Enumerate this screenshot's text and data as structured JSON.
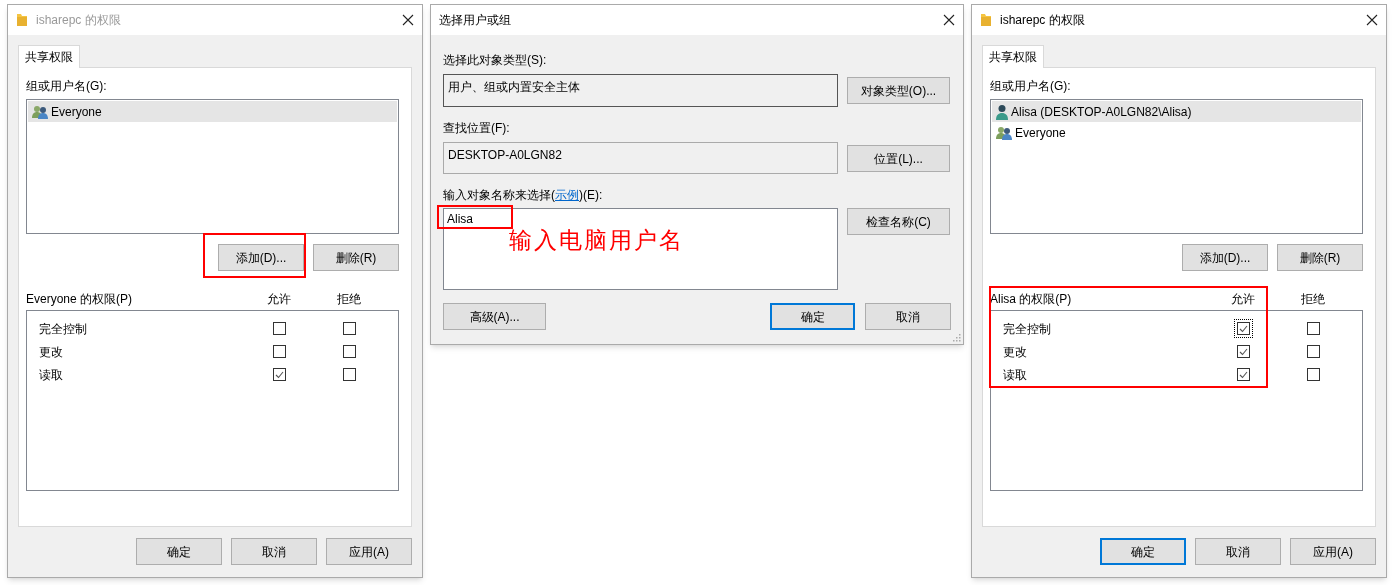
{
  "dialogs": [
    {
      "kind": "permissions",
      "title": "isharepc 的权限",
      "active": false,
      "tabs": [
        {
          "label": "共享权限",
          "selected": true
        }
      ],
      "group_label": "组或用户名(G):",
      "principals": [
        {
          "name": "Everyone",
          "kind": "group",
          "selected": true
        }
      ],
      "add_button": {
        "label": "添加(D)...",
        "highlighted": true
      },
      "remove_button": "删除(R)",
      "permissions_label": "Everyone 的权限(P)",
      "columns": [
        "允许",
        "拒绝"
      ],
      "permissions_highlighted": false,
      "permissions": [
        {
          "name": "完全控制",
          "allow": false,
          "deny": false,
          "focused": false
        },
        {
          "name": "更改",
          "allow": false,
          "deny": false,
          "focused": false
        },
        {
          "name": "读取",
          "allow": true,
          "deny": false,
          "focused": false
        }
      ],
      "buttons": [
        {
          "label": "确定",
          "default": false
        },
        {
          "label": "取消",
          "default": false
        },
        {
          "label": "应用(A)",
          "default": false
        }
      ]
    },
    {
      "kind": "select_user",
      "title": "选择用户或组",
      "active": true,
      "object_type_label": "选择此对象类型(S):",
      "object_type": "用户、组或内置安全主体",
      "object_type_button": "对象类型(O)...",
      "location_label": "查找位置(F):",
      "location": "DESKTOP-A0LGN82",
      "location_button": "位置(L)...",
      "name_label_before": "输入对象名称来选择(",
      "name_label_link": "示例",
      "name_label_after": ")(E):",
      "name_value": "Alisa",
      "name_highlighted": true,
      "annotation": "输入电脑用户名",
      "check_button": "检查名称(C)",
      "advanced_button": "高级(A)...",
      "buttons": [
        {
          "label": "确定",
          "default": true
        },
        {
          "label": "取消",
          "default": false
        }
      ]
    },
    {
      "kind": "permissions",
      "title": "isharepc 的权限",
      "active": true,
      "tabs": [
        {
          "label": "共享权限",
          "selected": true
        }
      ],
      "group_label": "组或用户名(G):",
      "principals": [
        {
          "name": "Alisa (DESKTOP-A0LGN82\\Alisa)",
          "kind": "user",
          "selected": true
        },
        {
          "name": "Everyone",
          "kind": "group",
          "selected": false
        }
      ],
      "add_button": {
        "label": "添加(D)...",
        "highlighted": false
      },
      "remove_button": "删除(R)",
      "permissions_label": "Alisa 的权限(P)",
      "columns": [
        "允许",
        "拒绝"
      ],
      "permissions_highlighted": true,
      "permissions": [
        {
          "name": "完全控制",
          "allow": true,
          "deny": false,
          "focused": true
        },
        {
          "name": "更改",
          "allow": true,
          "deny": false,
          "focused": false
        },
        {
          "name": "读取",
          "allow": true,
          "deny": false,
          "focused": false
        }
      ],
      "buttons": [
        {
          "label": "确定",
          "default": true
        },
        {
          "label": "取消",
          "default": false
        },
        {
          "label": "应用(A)",
          "default": false
        }
      ]
    }
  ]
}
